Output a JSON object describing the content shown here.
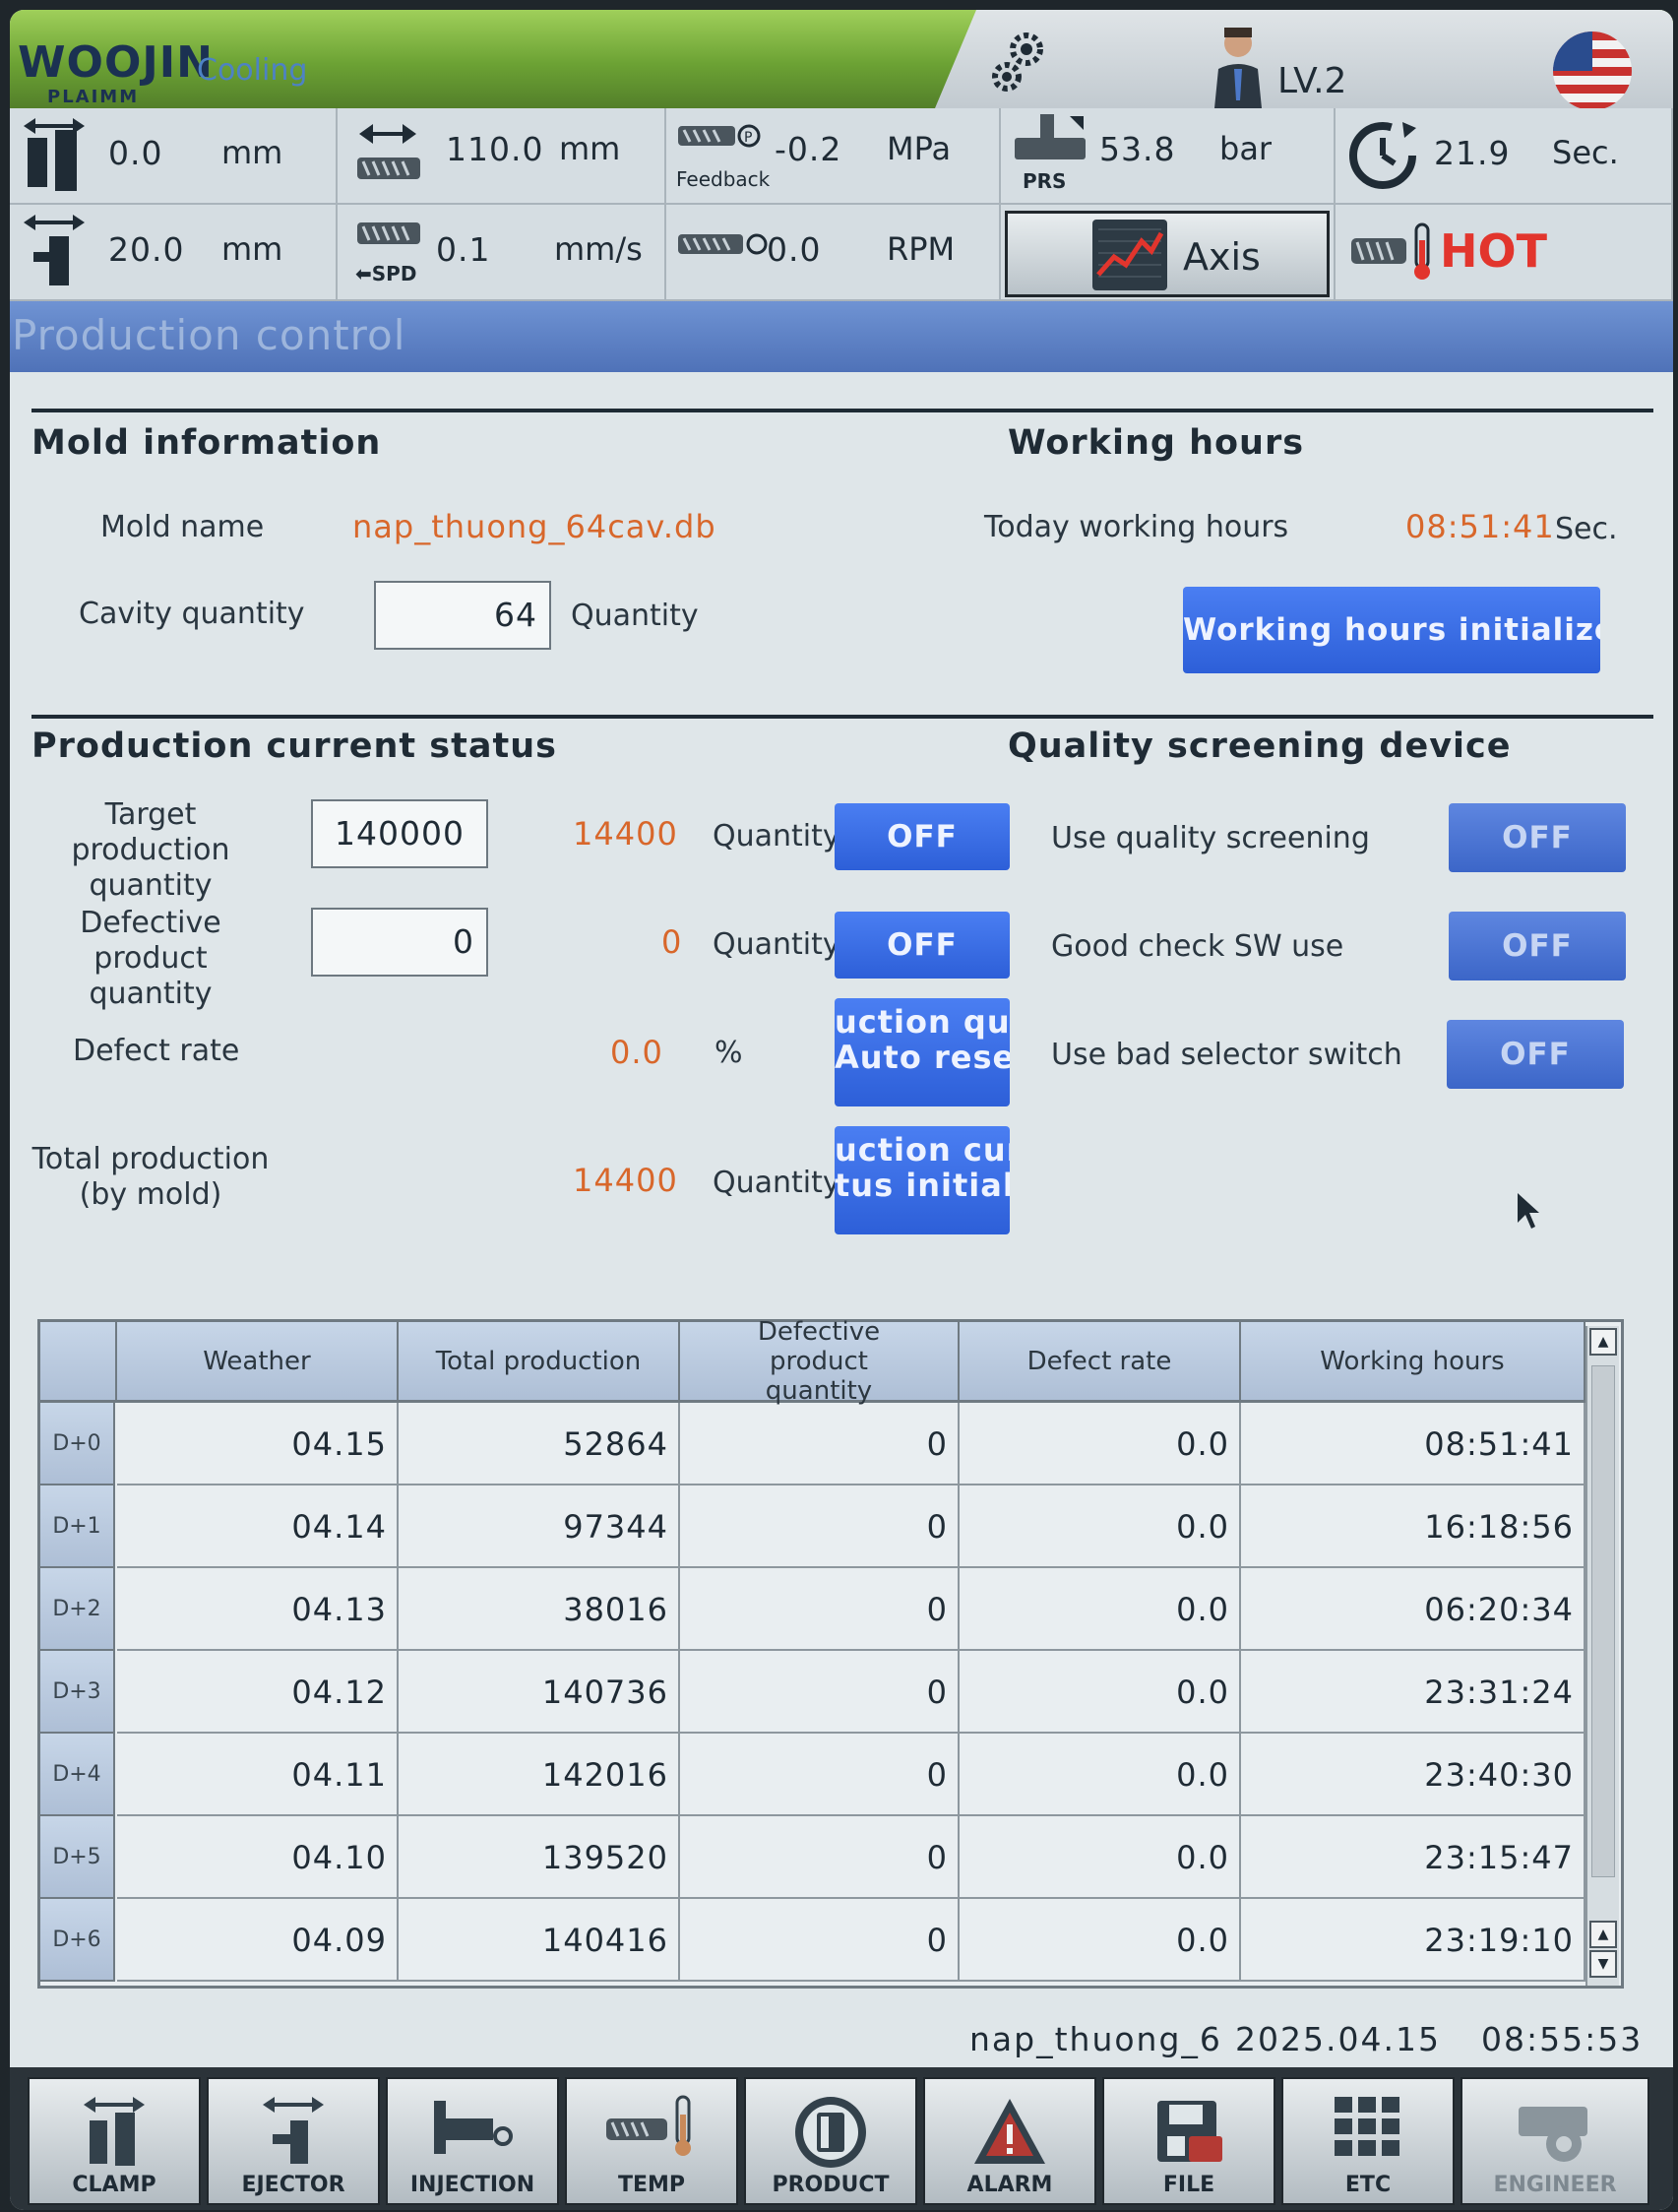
{
  "header": {
    "brand": "WOOJIN",
    "brand_sub": "PLAIMM",
    "mode": "Cooling",
    "level": "LV.2"
  },
  "status": {
    "clamp_pos": "0.0",
    "clamp_unit": "mm",
    "ejector_pos": "20.0",
    "ejector_unit": "mm",
    "screw_pos": "110.0",
    "screw_unit": "mm",
    "screw_speed": "0.1",
    "screw_speed_unit": "mm/s",
    "spd_label": "SPD",
    "pressure": "-0.2",
    "pressure_unit": "MPa",
    "feedback_label": "Feedback",
    "rpm": "0.0",
    "rpm_unit": "RPM",
    "prs": "53.8",
    "prs_unit": "bar",
    "prs_label": "PRS",
    "axis_label": "Axis",
    "cycle": "21.9",
    "cycle_unit": "Sec.",
    "hot_label": "HOT"
  },
  "title": "Production control",
  "mold": {
    "heading": "Mold information",
    "name_label": "Mold name",
    "name_value": "nap_thuong_64cav.db",
    "cavity_label": "Cavity quantity",
    "cavity_value": "64",
    "cavity_unit": "Quantity"
  },
  "hours": {
    "heading": "Working hours",
    "today_label": "Today working hours",
    "today_value": "08:51:41",
    "today_unit": "Sec.",
    "init_button": "Working hours initialize"
  },
  "production": {
    "heading": "Production current status",
    "target_label_1": "Target production",
    "target_label_2": "quantity",
    "target_value": "140000",
    "target_current": "14400",
    "target_unit": "Quantity",
    "target_toggle": "OFF",
    "defect_label_1": "Defective product",
    "defect_label_2": "quantity",
    "defect_value": "0",
    "defect_current": "0",
    "defect_unit": "Quantity",
    "defect_toggle": "OFF",
    "rate_label": "Defect rate",
    "rate_value": "0.0",
    "rate_unit": "%",
    "auto_reset_1": "uction qua",
    "auto_reset_2": "Auto reset",
    "total_label_1": "Total production",
    "total_label_2": "(by mold)",
    "total_value": "14400",
    "total_unit": "Quantity",
    "init_1": "uction cur",
    "init_2": "tus initiali"
  },
  "quality": {
    "heading": "Quality screening device",
    "use_label": "Use quality screening",
    "use_value": "OFF",
    "good_label": "Good check SW use",
    "good_value": "OFF",
    "bad_label": "Use bad selector switch",
    "bad_value": "OFF"
  },
  "table": {
    "headers": [
      "Weather",
      "Total production",
      "Defective product quantity",
      "Defect rate",
      "Working hours"
    ],
    "rows": [
      {
        "day": "D+0",
        "date": "04.15",
        "total": "52864",
        "defect": "0",
        "rate": "0.0",
        "hours": "08:51:41"
      },
      {
        "day": "D+1",
        "date": "04.14",
        "total": "97344",
        "defect": "0",
        "rate": "0.0",
        "hours": "16:18:56"
      },
      {
        "day": "D+2",
        "date": "04.13",
        "total": "38016",
        "defect": "0",
        "rate": "0.0",
        "hours": "06:20:34"
      },
      {
        "day": "D+3",
        "date": "04.12",
        "total": "140736",
        "defect": "0",
        "rate": "0.0",
        "hours": "23:31:24"
      },
      {
        "day": "D+4",
        "date": "04.11",
        "total": "142016",
        "defect": "0",
        "rate": "0.0",
        "hours": "23:40:30"
      },
      {
        "day": "D+5",
        "date": "04.10",
        "total": "139520",
        "defect": "0",
        "rate": "0.0",
        "hours": "23:15:47"
      },
      {
        "day": "D+6",
        "date": "04.09",
        "total": "140416",
        "defect": "0",
        "rate": "0.0",
        "hours": "23:19:10"
      }
    ]
  },
  "footer": {
    "file": "nap_thuong_6",
    "date": "2025.04.15",
    "time": "08:55:53"
  },
  "nav": [
    "CLAMP",
    "EJECTOR",
    "INJECTION",
    "TEMP",
    "PRODUCT",
    "ALARM",
    "FILE",
    "ETC",
    "ENGINEER"
  ],
  "colors": {
    "accent_button": "#3a6ce0",
    "value_orange": "#d8672b",
    "hot_red": "#e2352d",
    "title_bar": "#5a7dc4"
  }
}
